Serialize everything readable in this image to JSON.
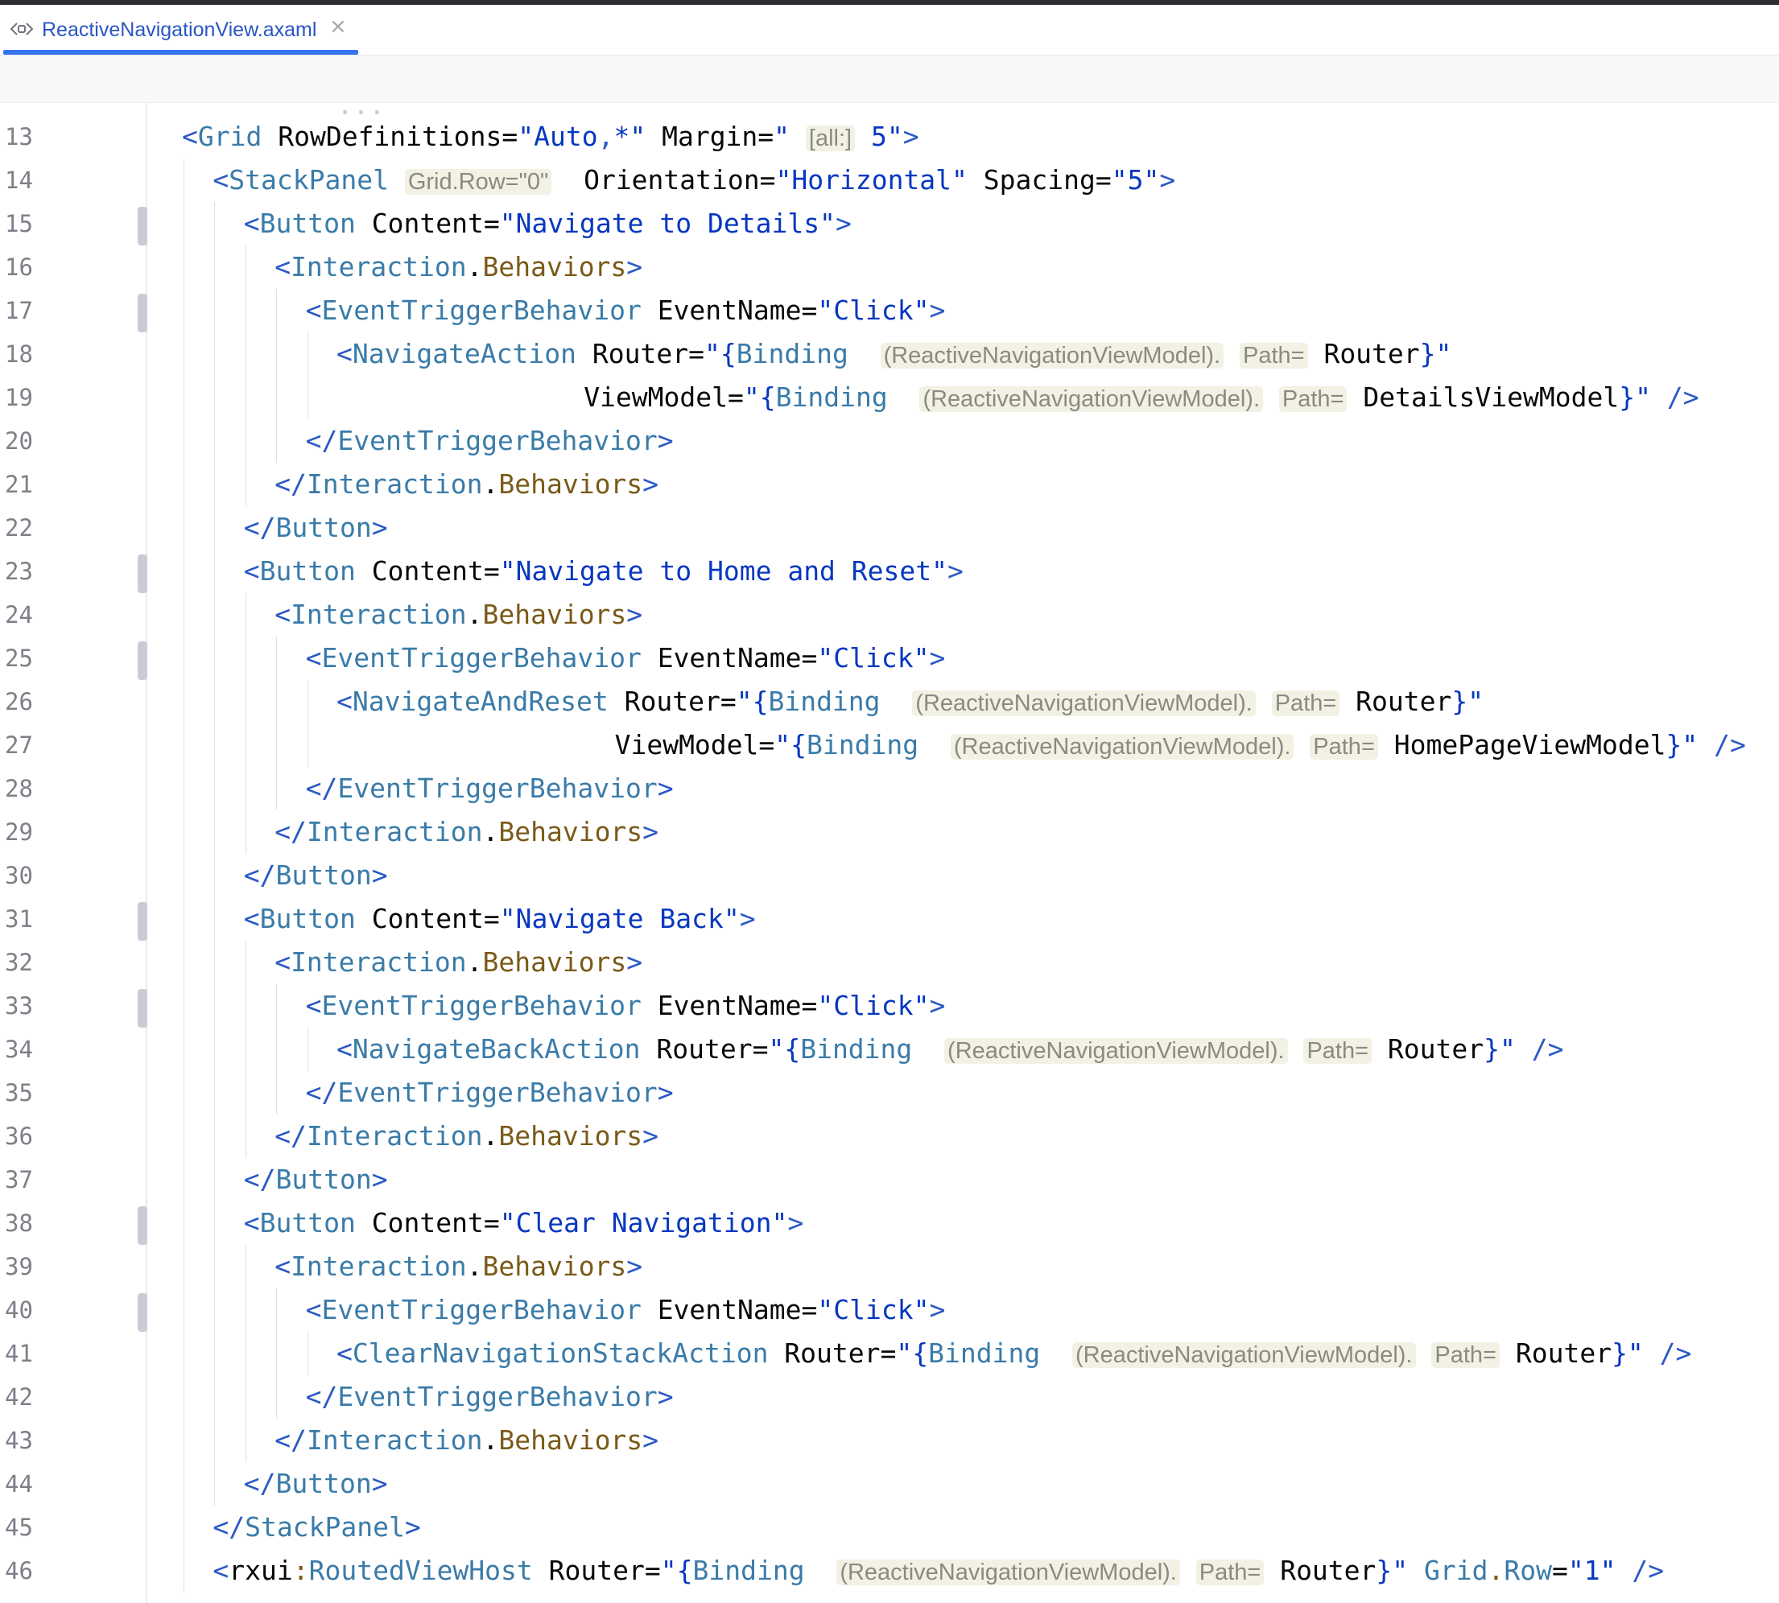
{
  "editor_tab": {
    "title": "ReactiveNavigationView.axaml",
    "close_glyph": "×",
    "icon": "axaml-file-icon"
  },
  "lines": [
    {
      "n": "13",
      "indent": 0,
      "t": [
        [
          "tag",
          "<"
        ],
        [
          "el",
          "Grid"
        ],
        [
          "at",
          " RowDefinitions="
        ],
        [
          "st",
          "\"Auto"
        ],
        [
          "tag",
          ","
        ],
        [
          "st",
          "*\""
        ],
        [
          "at",
          " Margin="
        ],
        [
          "st",
          "\""
        ],
        [
          "sp",
          " "
        ],
        [
          "hint",
          "[all:]"
        ],
        [
          "st",
          " 5\""
        ],
        [
          "tag",
          ">"
        ]
      ]
    },
    {
      "n": "14",
      "indent": 1,
      "t": [
        [
          "tag",
          "<"
        ],
        [
          "el",
          "StackPanel"
        ],
        [
          "sp",
          " "
        ],
        [
          "hint",
          "Grid.Row=\"0\""
        ],
        [
          "at",
          "  Orientation="
        ],
        [
          "st",
          "\"Horizontal\""
        ],
        [
          "at",
          " Spacing="
        ],
        [
          "st",
          "\"5\""
        ],
        [
          "tag",
          ">"
        ]
      ]
    },
    {
      "n": "15",
      "indent": 2,
      "mark": true,
      "t": [
        [
          "tag",
          "<"
        ],
        [
          "el",
          "Button"
        ],
        [
          "at",
          " Content="
        ],
        [
          "st",
          "\"Navigate to Details\""
        ],
        [
          "tag",
          ">"
        ]
      ]
    },
    {
      "n": "16",
      "indent": 3,
      "t": [
        [
          "tag",
          "<"
        ],
        [
          "el",
          "Interaction"
        ],
        [
          "at",
          "."
        ],
        [
          "ns",
          "Behaviors"
        ],
        [
          "tag",
          ">"
        ]
      ]
    },
    {
      "n": "17",
      "indent": 4,
      "mark": true,
      "t": [
        [
          "tag",
          "<"
        ],
        [
          "el",
          "EventTriggerBehavior"
        ],
        [
          "at",
          " EventName="
        ],
        [
          "st",
          "\"Click\""
        ],
        [
          "tag",
          ">"
        ]
      ]
    },
    {
      "n": "18",
      "indent": 5,
      "t": [
        [
          "tag",
          "<"
        ],
        [
          "el",
          "NavigateAction"
        ],
        [
          "at",
          " Router="
        ],
        [
          "st",
          "\"{"
        ],
        [
          "el",
          "Binding"
        ],
        [
          "sp",
          "  "
        ],
        [
          "hint",
          "(ReactiveNavigationViewModel)."
        ],
        [
          "sp",
          " "
        ],
        [
          "hint",
          "Path="
        ],
        [
          "at",
          " Router"
        ],
        [
          "st",
          "}\""
        ]
      ]
    },
    {
      "n": "19",
      "indent": 5,
      "pad": 16,
      "t": [
        [
          "at",
          "ViewModel="
        ],
        [
          "st",
          "\"{"
        ],
        [
          "el",
          "Binding"
        ],
        [
          "sp",
          "  "
        ],
        [
          "hint",
          "(ReactiveNavigationViewModel)."
        ],
        [
          "sp",
          " "
        ],
        [
          "hint",
          "Path="
        ],
        [
          "at",
          " DetailsViewModel"
        ],
        [
          "st",
          "}\""
        ],
        [
          "tag",
          " />"
        ]
      ]
    },
    {
      "n": "20",
      "indent": 4,
      "t": [
        [
          "tag",
          "</"
        ],
        [
          "el",
          "EventTriggerBehavior"
        ],
        [
          "tag",
          ">"
        ]
      ]
    },
    {
      "n": "21",
      "indent": 3,
      "t": [
        [
          "tag",
          "</"
        ],
        [
          "el",
          "Interaction"
        ],
        [
          "at",
          "."
        ],
        [
          "ns",
          "Behaviors"
        ],
        [
          "tag",
          ">"
        ]
      ]
    },
    {
      "n": "22",
      "indent": 2,
      "t": [
        [
          "tag",
          "</"
        ],
        [
          "el",
          "Button"
        ],
        [
          "tag",
          ">"
        ]
      ]
    },
    {
      "n": "23",
      "indent": 2,
      "mark": true,
      "t": [
        [
          "tag",
          "<"
        ],
        [
          "el",
          "Button"
        ],
        [
          "at",
          " Content="
        ],
        [
          "st",
          "\"Navigate to Home and Reset\""
        ],
        [
          "tag",
          ">"
        ]
      ]
    },
    {
      "n": "24",
      "indent": 3,
      "t": [
        [
          "tag",
          "<"
        ],
        [
          "el",
          "Interaction"
        ],
        [
          "at",
          "."
        ],
        [
          "ns",
          "Behaviors"
        ],
        [
          "tag",
          ">"
        ]
      ]
    },
    {
      "n": "25",
      "indent": 4,
      "mark": true,
      "t": [
        [
          "tag",
          "<"
        ],
        [
          "el",
          "EventTriggerBehavior"
        ],
        [
          "at",
          " EventName="
        ],
        [
          "st",
          "\"Click\""
        ],
        [
          "tag",
          ">"
        ]
      ]
    },
    {
      "n": "26",
      "indent": 5,
      "t": [
        [
          "tag",
          "<"
        ],
        [
          "el",
          "NavigateAndReset"
        ],
        [
          "at",
          " Router="
        ],
        [
          "st",
          "\"{"
        ],
        [
          "el",
          "Binding"
        ],
        [
          "sp",
          "  "
        ],
        [
          "hint",
          "(ReactiveNavigationViewModel)."
        ],
        [
          "sp",
          " "
        ],
        [
          "hint",
          "Path="
        ],
        [
          "at",
          " Router"
        ],
        [
          "st",
          "}\""
        ]
      ]
    },
    {
      "n": "27",
      "indent": 5,
      "pad": 18,
      "t": [
        [
          "at",
          "ViewModel="
        ],
        [
          "st",
          "\"{"
        ],
        [
          "el",
          "Binding"
        ],
        [
          "sp",
          "  "
        ],
        [
          "hint",
          "(ReactiveNavigationViewModel)."
        ],
        [
          "sp",
          " "
        ],
        [
          "hint",
          "Path="
        ],
        [
          "at",
          " HomePageViewModel"
        ],
        [
          "st",
          "}\""
        ],
        [
          "tag",
          " />"
        ]
      ]
    },
    {
      "n": "28",
      "indent": 4,
      "t": [
        [
          "tag",
          "</"
        ],
        [
          "el",
          "EventTriggerBehavior"
        ],
        [
          "tag",
          ">"
        ]
      ]
    },
    {
      "n": "29",
      "indent": 3,
      "t": [
        [
          "tag",
          "</"
        ],
        [
          "el",
          "Interaction"
        ],
        [
          "at",
          "."
        ],
        [
          "ns",
          "Behaviors"
        ],
        [
          "tag",
          ">"
        ]
      ]
    },
    {
      "n": "30",
      "indent": 2,
      "t": [
        [
          "tag",
          "</"
        ],
        [
          "el",
          "Button"
        ],
        [
          "tag",
          ">"
        ]
      ]
    },
    {
      "n": "31",
      "indent": 2,
      "mark": true,
      "t": [
        [
          "tag",
          "<"
        ],
        [
          "el",
          "Button"
        ],
        [
          "at",
          " Content="
        ],
        [
          "st",
          "\"Navigate Back\""
        ],
        [
          "tag",
          ">"
        ]
      ]
    },
    {
      "n": "32",
      "indent": 3,
      "t": [
        [
          "tag",
          "<"
        ],
        [
          "el",
          "Interaction"
        ],
        [
          "at",
          "."
        ],
        [
          "ns",
          "Behaviors"
        ],
        [
          "tag",
          ">"
        ]
      ]
    },
    {
      "n": "33",
      "indent": 4,
      "mark": true,
      "t": [
        [
          "tag",
          "<"
        ],
        [
          "el",
          "EventTriggerBehavior"
        ],
        [
          "at",
          " EventName="
        ],
        [
          "st",
          "\"Click\""
        ],
        [
          "tag",
          ">"
        ]
      ]
    },
    {
      "n": "34",
      "indent": 5,
      "t": [
        [
          "tag",
          "<"
        ],
        [
          "el",
          "NavigateBackAction"
        ],
        [
          "at",
          " Router="
        ],
        [
          "st",
          "\"{"
        ],
        [
          "el",
          "Binding"
        ],
        [
          "sp",
          "  "
        ],
        [
          "hint",
          "(ReactiveNavigationViewModel)."
        ],
        [
          "sp",
          " "
        ],
        [
          "hint",
          "Path="
        ],
        [
          "at",
          " Router"
        ],
        [
          "st",
          "}\""
        ],
        [
          "tag",
          " />"
        ]
      ]
    },
    {
      "n": "35",
      "indent": 4,
      "t": [
        [
          "tag",
          "</"
        ],
        [
          "el",
          "EventTriggerBehavior"
        ],
        [
          "tag",
          ">"
        ]
      ]
    },
    {
      "n": "36",
      "indent": 3,
      "t": [
        [
          "tag",
          "</"
        ],
        [
          "el",
          "Interaction"
        ],
        [
          "at",
          "."
        ],
        [
          "ns",
          "Behaviors"
        ],
        [
          "tag",
          ">"
        ]
      ]
    },
    {
      "n": "37",
      "indent": 2,
      "t": [
        [
          "tag",
          "</"
        ],
        [
          "el",
          "Button"
        ],
        [
          "tag",
          ">"
        ]
      ]
    },
    {
      "n": "38",
      "indent": 2,
      "mark": true,
      "t": [
        [
          "tag",
          "<"
        ],
        [
          "el",
          "Button"
        ],
        [
          "at",
          " Content="
        ],
        [
          "st",
          "\"Clear Navigation\""
        ],
        [
          "tag",
          ">"
        ]
      ]
    },
    {
      "n": "39",
      "indent": 3,
      "t": [
        [
          "tag",
          "<"
        ],
        [
          "el",
          "Interaction"
        ],
        [
          "at",
          "."
        ],
        [
          "ns",
          "Behaviors"
        ],
        [
          "tag",
          ">"
        ]
      ]
    },
    {
      "n": "40",
      "indent": 4,
      "mark": true,
      "t": [
        [
          "tag",
          "<"
        ],
        [
          "el",
          "EventTriggerBehavior"
        ],
        [
          "at",
          " EventName="
        ],
        [
          "st",
          "\"Click\""
        ],
        [
          "tag",
          ">"
        ]
      ]
    },
    {
      "n": "41",
      "indent": 5,
      "t": [
        [
          "tag",
          "<"
        ],
        [
          "el",
          "ClearNavigationStackAction"
        ],
        [
          "at",
          " Router="
        ],
        [
          "st",
          "\"{"
        ],
        [
          "el",
          "Binding"
        ],
        [
          "sp",
          "  "
        ],
        [
          "hint",
          "(ReactiveNavigationViewModel)."
        ],
        [
          "sp",
          " "
        ],
        [
          "hint",
          "Path="
        ],
        [
          "at",
          " Router"
        ],
        [
          "st",
          "}\""
        ],
        [
          "tag",
          " />"
        ]
      ]
    },
    {
      "n": "42",
      "indent": 4,
      "t": [
        [
          "tag",
          "</"
        ],
        [
          "el",
          "EventTriggerBehavior"
        ],
        [
          "tag",
          ">"
        ]
      ]
    },
    {
      "n": "43",
      "indent": 3,
      "t": [
        [
          "tag",
          "</"
        ],
        [
          "el",
          "Interaction"
        ],
        [
          "at",
          "."
        ],
        [
          "ns",
          "Behaviors"
        ],
        [
          "tag",
          ">"
        ]
      ]
    },
    {
      "n": "44",
      "indent": 2,
      "t": [
        [
          "tag",
          "</"
        ],
        [
          "el",
          "Button"
        ],
        [
          "tag",
          ">"
        ]
      ]
    },
    {
      "n": "45",
      "indent": 1,
      "t": [
        [
          "tag",
          "</"
        ],
        [
          "el",
          "StackPanel"
        ],
        [
          "tag",
          ">"
        ]
      ]
    },
    {
      "n": "46",
      "indent": 1,
      "t": [
        [
          "tag",
          "<"
        ],
        [
          "at",
          "rxui"
        ],
        [
          "ns",
          ":"
        ],
        [
          "el",
          "RoutedViewHost"
        ],
        [
          "at",
          " Router="
        ],
        [
          "st",
          "\"{"
        ],
        [
          "el",
          "Binding"
        ],
        [
          "sp",
          "  "
        ],
        [
          "hint",
          "(ReactiveNavigationViewModel)."
        ],
        [
          "sp",
          " "
        ],
        [
          "hint",
          "Path="
        ],
        [
          "at",
          " Router"
        ],
        [
          "st",
          "}\""
        ],
        [
          "el",
          " Grid"
        ],
        [
          "ns",
          "."
        ],
        [
          "el",
          "Row"
        ],
        [
          "at",
          "="
        ],
        [
          "st",
          "\"1\""
        ],
        [
          "tag",
          " />"
        ]
      ]
    }
  ],
  "colors": {
    "tag": "#2b59c4",
    "element": "#3a7ba8",
    "string": "#0637c0",
    "namespace_part": "#7a5a18",
    "hint_background": "#f3f1e3",
    "tab_accent": "#3574f0"
  }
}
